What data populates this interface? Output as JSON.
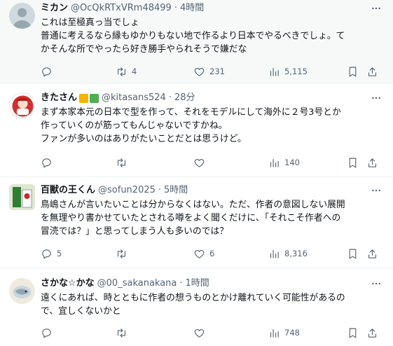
{
  "tweets": [
    {
      "name": "ミカン",
      "handle": "@OcQkRTxVRm48499",
      "sep": "·",
      "time": "4時間",
      "text": "これは至極真っ当でしょ\n普通に考えるなら縁もゆかりもない地で作るより日本でやるべきでしょ。て\nかそんな所でやったら好き勝手やられそうで嫌だな",
      "reply_count": "",
      "retweet_count": "4",
      "like_count": "231",
      "views": "5,115"
    },
    {
      "name": "きたさん",
      "handle": "@kitasans524",
      "sep": "·",
      "time": "28分",
      "text": "まず本家本元の日本で型を作って、それをモデルにして海外に２号3号とか\n作っていくのが筋ってもんじゃないですかね。\nファンが多いのはありがたいことだとは思うけど。",
      "reply_count": "",
      "retweet_count": "",
      "like_count": "",
      "views": "140"
    },
    {
      "name": "百獣の王くん",
      "handle": "@sofun2025",
      "sep": "·",
      "time": "5時間",
      "text": "鳥嶋さんが言いたいことは分からなくはない。ただ、作者の意図しない展開\nを無理やり書かせていたとされる噂をよく聞くだけに、「それこそ作者への\n冒涜では？」と思ってしまう人も多いのでは？",
      "reply_count": "5",
      "retweet_count": "",
      "like_count": "6",
      "views": "8,316"
    },
    {
      "name": "さかな☆かな",
      "handle": "@00_sakanakana",
      "sep": "·",
      "time": "1時間",
      "text": "遠くにあれば、時とともに作者の想うものとかけ離れていく可能性があるの\nで、宜しくないかと",
      "reply_count": "",
      "retweet_count": "",
      "like_count": "",
      "views": "748"
    }
  ],
  "icons": {
    "reply": "reply-icon",
    "retweet": "retweet-icon",
    "like": "heart-icon",
    "views": "views-icon",
    "bookmark": "bookmark-icon",
    "share": "share-icon",
    "more": "more-icon"
  },
  "colors": {
    "text": "#0f1419",
    "secondary": "#536471",
    "divider": "#eff3f4",
    "highlight_bg": "#f7f9f9",
    "badge_beer": "#f4b400",
    "badge_check": "#4caf50"
  }
}
